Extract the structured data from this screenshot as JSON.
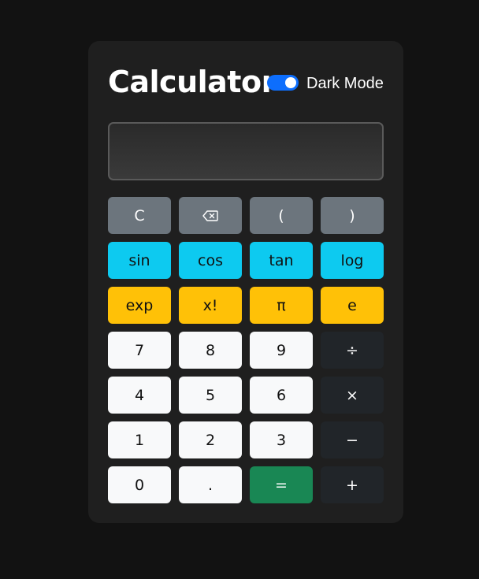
{
  "app": {
    "title": "Calculator",
    "dark_mode_label": "Dark Mode",
    "dark_mode_on": true
  },
  "display": {
    "value": ""
  },
  "colors": {
    "page_bg": "#121212",
    "card_bg": "#1f1f1f",
    "toggle_on": "#0d6efd",
    "gray": "#6c757d",
    "cyan": "#0dcaf0",
    "yellow": "#ffc107",
    "light": "#f8f9fa",
    "dark": "#212529",
    "green": "#198754"
  },
  "buttons": {
    "clear": "C",
    "backspace_icon": "backspace-icon",
    "open_paren": "(",
    "close_paren": ")",
    "sin": "sin",
    "cos": "cos",
    "tan": "tan",
    "log": "log",
    "exp": "exp",
    "factorial": "x!",
    "pi": "π",
    "e": "e",
    "seven": "7",
    "eight": "8",
    "nine": "9",
    "divide": "÷",
    "four": "4",
    "five": "5",
    "six": "6",
    "multiply": "×",
    "one": "1",
    "two": "2",
    "three": "3",
    "minus": "−",
    "zero": "0",
    "decimal": ".",
    "equals": "=",
    "plus": "+"
  }
}
